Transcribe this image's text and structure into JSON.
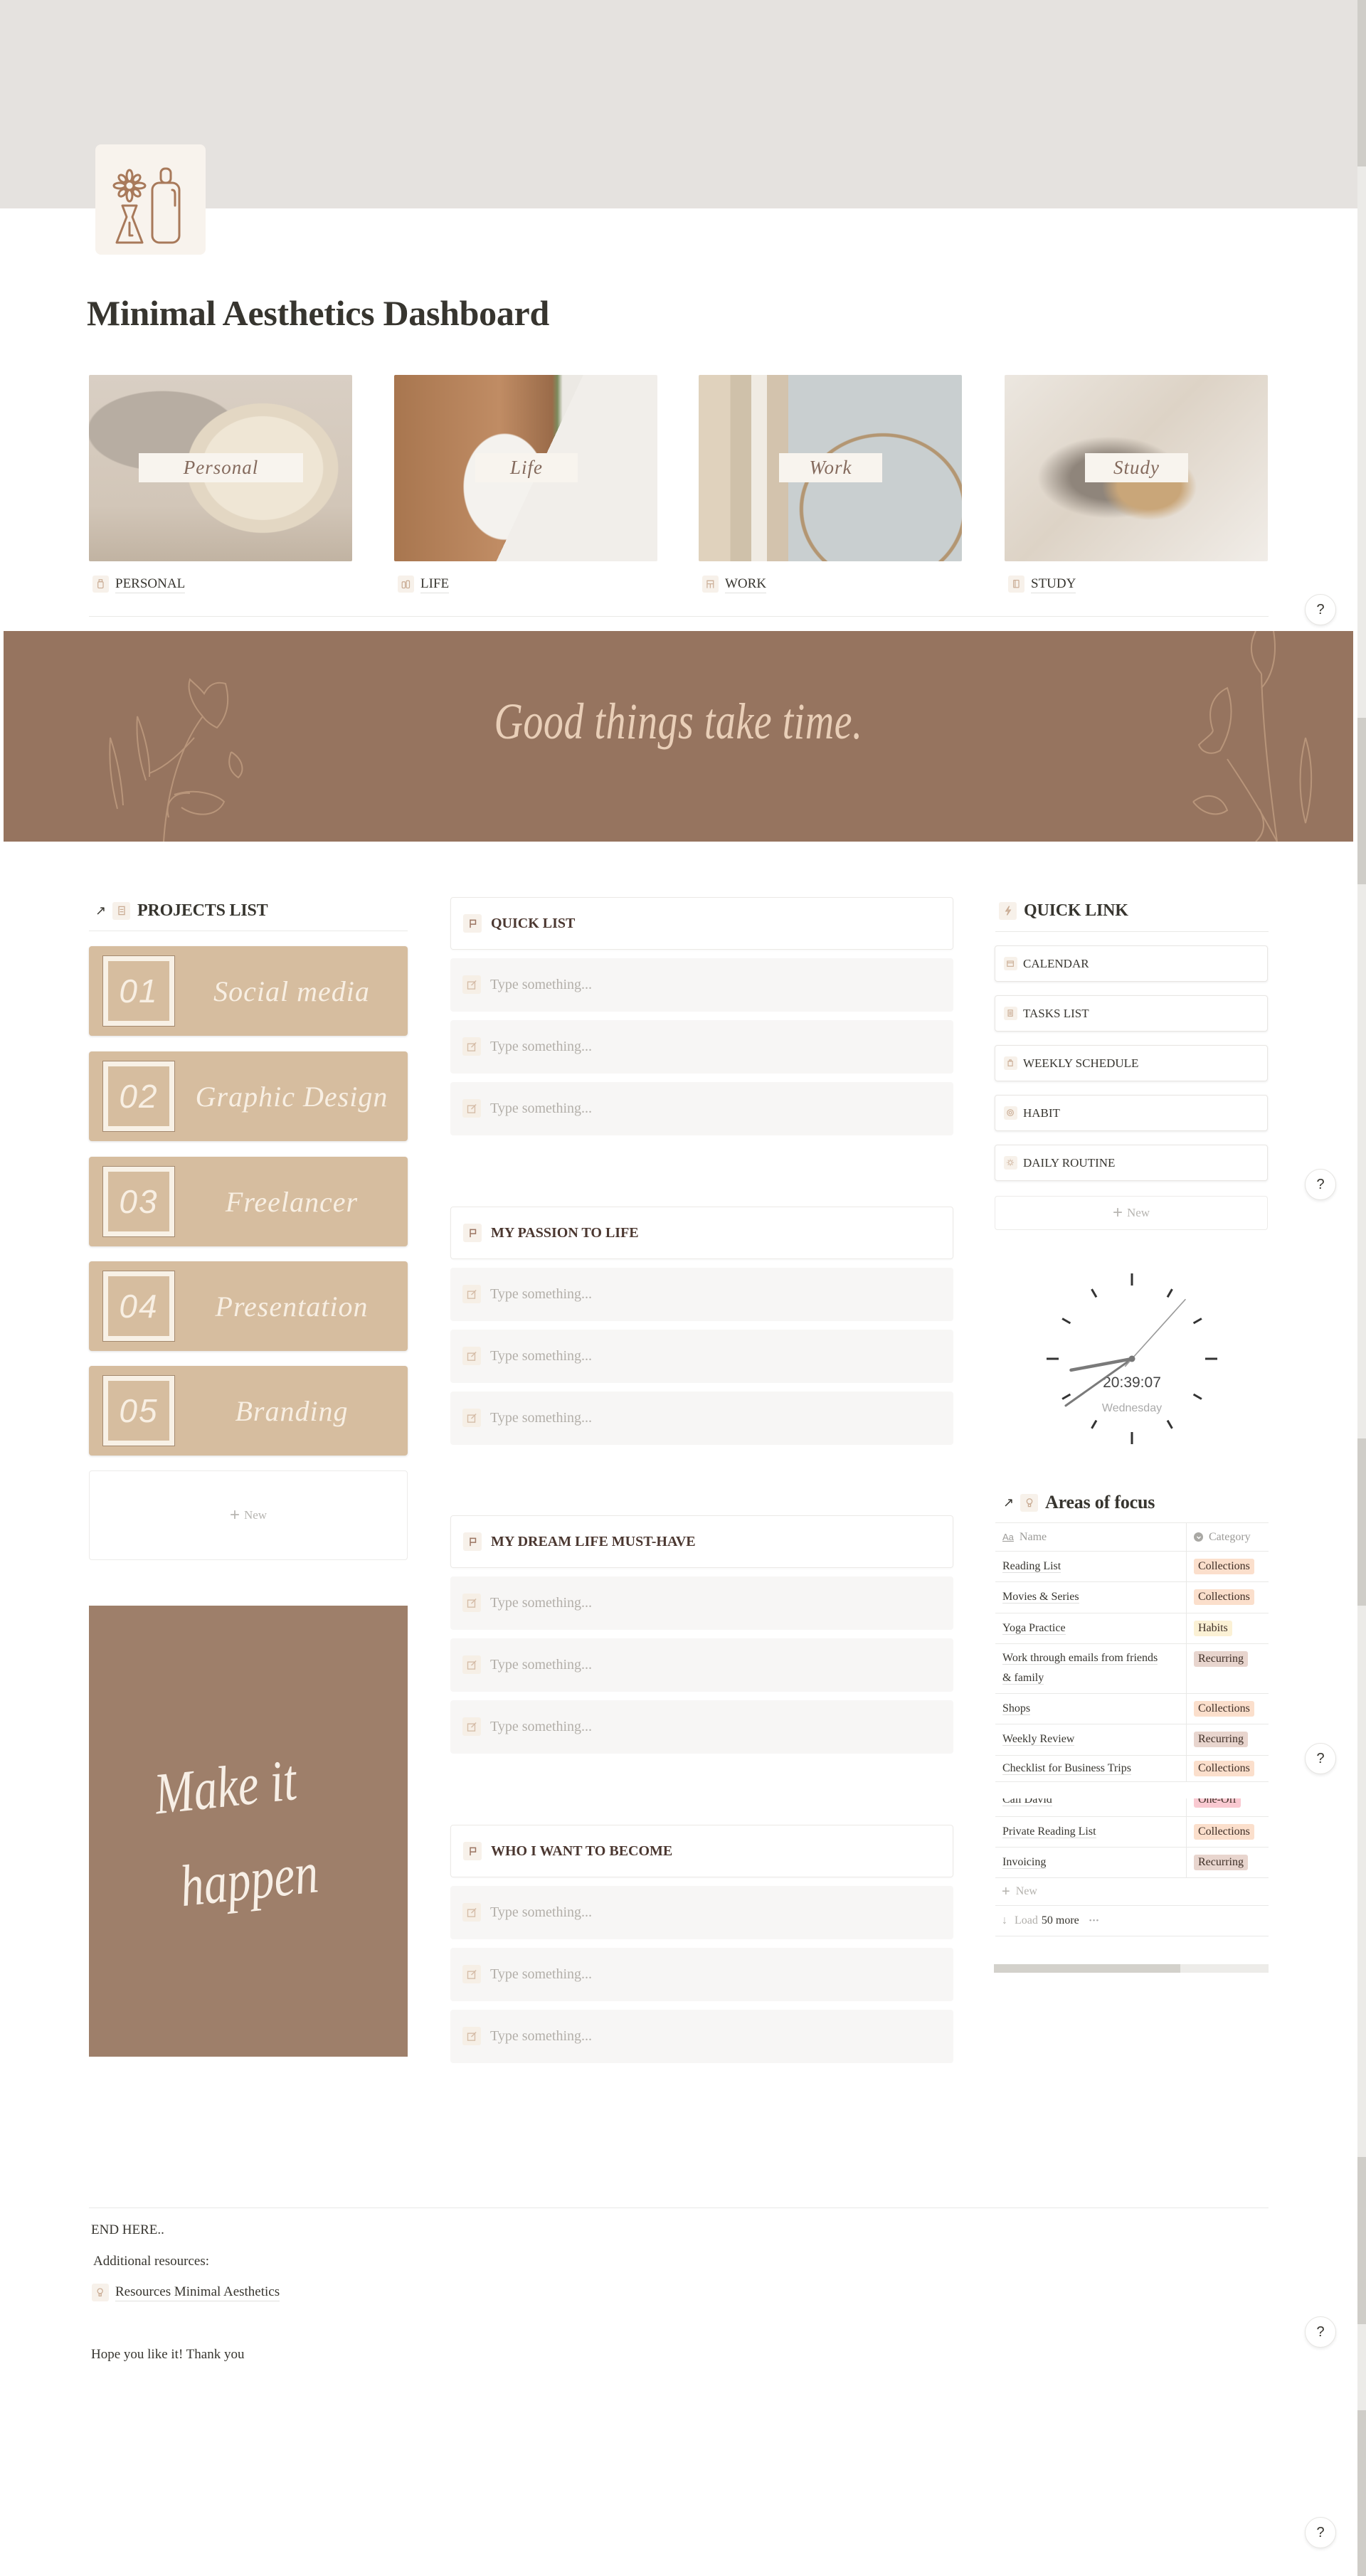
{
  "page": {
    "title": "Minimal Aesthetics Dashboard",
    "icon": "vase-and-bottle-icon"
  },
  "gallery": [
    {
      "overlay": "Personal",
      "label": "PERSONAL",
      "icon": "bottle-icon"
    },
    {
      "overlay": "Life",
      "label": "LIFE",
      "icon": "bottles-icon"
    },
    {
      "overlay": "Work",
      "label": "WORK",
      "icon": "chair-icon"
    },
    {
      "overlay": "Study",
      "label": "STUDY",
      "icon": "book-icon"
    }
  ],
  "banner": {
    "quote": "Good things take time."
  },
  "projects": {
    "title": "PROJECTS LIST",
    "items": [
      {
        "number": "01",
        "name": "Social media"
      },
      {
        "number": "02",
        "name": "Graphic Design"
      },
      {
        "number": "03",
        "name": "Freelancer"
      },
      {
        "number": "04",
        "name": "Presentation"
      },
      {
        "number": "05",
        "name": "Branding"
      }
    ],
    "new_label": "New"
  },
  "motivation": {
    "line1": "Make it",
    "line2": "happen"
  },
  "lists": [
    {
      "title": "QUICK LIST",
      "items": [
        "Type something...",
        "Type something...",
        "Type something..."
      ]
    },
    {
      "title": "MY PASSION TO LIFE",
      "items": [
        "Type something...",
        "Type something...",
        "Type something..."
      ]
    },
    {
      "title": "MY DREAM LIFE MUST-HAVE",
      "items": [
        "Type something...",
        "Type something...",
        "Type something..."
      ]
    },
    {
      "title": "WHO I WANT TO BECOME",
      "items": [
        "Type something...",
        "Type something...",
        "Type something..."
      ]
    }
  ],
  "quick_link": {
    "title": "QUICK LINK",
    "items": [
      {
        "label": "CALENDAR",
        "icon": "calendar-icon"
      },
      {
        "label": "TASKS LIST",
        "icon": "notebook-icon"
      },
      {
        "label": "WEEKLY SCHEDULE",
        "icon": "clipboard-icon"
      },
      {
        "label": "HABIT",
        "icon": "target-icon"
      },
      {
        "label": "DAILY ROUTINE",
        "icon": "sun-icon"
      }
    ],
    "new_label": "New"
  },
  "clock": {
    "time": "20:39:07",
    "day": "Wednesday"
  },
  "areas": {
    "title": "Areas of focus",
    "columns": {
      "name": "Name",
      "name_icon": "Aa",
      "category": "Category"
    },
    "rows": [
      {
        "name": "Reading List",
        "category": "Collections"
      },
      {
        "name": "Movies & Series",
        "category": "Collections"
      },
      {
        "name": "Yoga Practice",
        "category": "Habits"
      },
      {
        "name": "Work through emails from friends & family",
        "category": "Recurring"
      },
      {
        "name": "Shops",
        "category": "Collections"
      },
      {
        "name": "Weekly Review",
        "category": "Recurring"
      },
      {
        "name": "Checklist for Business Trips",
        "category": "Collections"
      },
      {
        "name": "Call David",
        "category": "One-Off"
      },
      {
        "name": "Private Reading List",
        "category": "Collections"
      },
      {
        "name": "Invoicing",
        "category": "Recurring"
      }
    ],
    "new_label": "New",
    "load_more": {
      "load": "Load",
      "count": "50 more",
      "more": "•••"
    },
    "tag_colors": {
      "Collections": "#fbdfcc",
      "Habits": "#fbf1d5",
      "Recurring": "#e8d5ce",
      "One-Off": "#f9c9d1"
    },
    "horizontal_scroll_visible_fraction": 0.68
  },
  "footer": {
    "end": "END HERE..",
    "additional": "Additional resources:",
    "resource_link": "Resources Minimal Aesthetics",
    "thanks": "Hope you like it! Thank you"
  },
  "help": {
    "label": "?"
  },
  "colors": {
    "cover": "#e5e2df",
    "banner": "#96745f",
    "project_card": "#d6bd9f",
    "motivation_card": "#9e7f6a",
    "icon_tint": "#a8795a"
  }
}
